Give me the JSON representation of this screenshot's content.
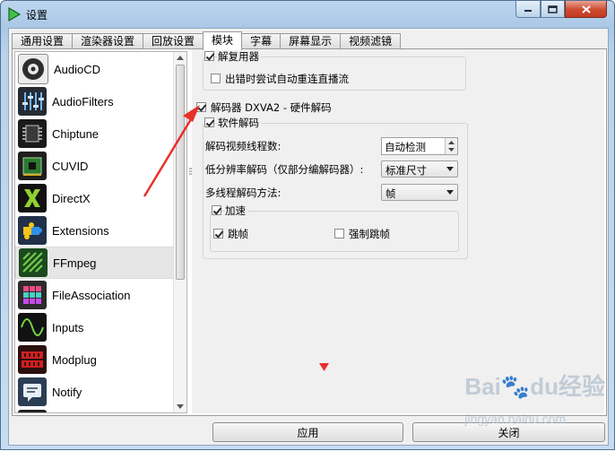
{
  "window": {
    "title": "设置"
  },
  "tabs": [
    "通用设置",
    "渲染器设置",
    "回放设置",
    "模块",
    "字幕",
    "屏幕显示",
    "视频滤镜"
  ],
  "active_tab": "模块",
  "modules": [
    {
      "label": "AudioCD",
      "icon": "audiocd-disc-icon"
    },
    {
      "label": "AudioFilters",
      "icon": "audiofilters-sliders-icon"
    },
    {
      "label": "Chiptune",
      "icon": "chiptune-chip-icon"
    },
    {
      "label": "CUVID",
      "icon": "cuvid-card-icon"
    },
    {
      "label": "DirectX",
      "icon": "directx-icon"
    },
    {
      "label": "Extensions",
      "icon": "extensions-puzzle-icon"
    },
    {
      "label": "FFmpeg",
      "icon": "ffmpeg-icon"
    },
    {
      "label": "FileAssociation",
      "icon": "fileassociation-grid-icon"
    },
    {
      "label": "Inputs",
      "icon": "inputs-wave-icon"
    },
    {
      "label": "Modplug",
      "icon": "modplug-icon"
    },
    {
      "label": "Notify",
      "icon": "notify-icon"
    }
  ],
  "selected_module": "FFmpeg",
  "settings": {
    "demuxer": {
      "label": "解复用器",
      "checked": true
    },
    "reconnect": {
      "label": "出错时尝试自动重连直播流",
      "checked": false
    },
    "dxva2": {
      "label": "解码器 DXVA2 - 硬件解码",
      "checked": true
    },
    "software": {
      "label": "软件解码",
      "checked": true
    },
    "threads_label": "解码视频线程数:",
    "threads_value": "自动检测",
    "lowres_label": "低分辨率解码（仅部分编解码器）:",
    "lowres_value": "标准尺寸",
    "thread_method_label": "多线程解码方法:",
    "thread_method_value": "帧",
    "accelerate": {
      "label": "加速",
      "checked": true
    },
    "skip_frames": {
      "label": "跳帧",
      "checked": true
    },
    "force_skip_frames": {
      "label": "强制跳帧",
      "checked": false
    }
  },
  "buttons": {
    "apply": "应用",
    "close": "关闭"
  },
  "watermark": {
    "main": "Bai",
    "paw": "du",
    "suffix": "经验",
    "url": "jingyan.baidu.com"
  },
  "colors": {
    "annotation_red": "#e8302a",
    "close_red": "#c9432b"
  }
}
